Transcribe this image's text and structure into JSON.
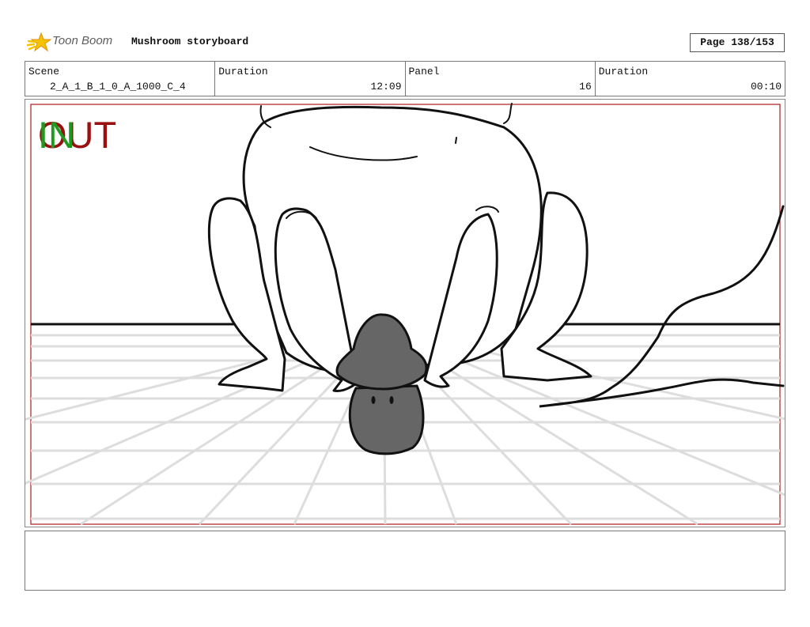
{
  "header": {
    "logo_text": "Toon Boom",
    "document_title": "Mushroom storyboard",
    "page_indicator": "Page 138/153"
  },
  "info_table": {
    "scene_label": "Scene",
    "scene_value": "2_A_1_B_1_0_A_1000_C_4",
    "duration_label": "Duration",
    "duration_value": "12:09",
    "panel_label": "Panel",
    "panel_value": "16",
    "panel_duration_label": "Duration",
    "panel_duration_value": "00:10"
  },
  "panel": {
    "out_marker": "OUT",
    "in_marker": "IN"
  },
  "colors": {
    "frame_red": "#b11a1a",
    "in_green": "#1f9a1f",
    "out_red": "#9a1010",
    "mushroom_gray": "#666666"
  },
  "notes": {
    "text": ""
  }
}
